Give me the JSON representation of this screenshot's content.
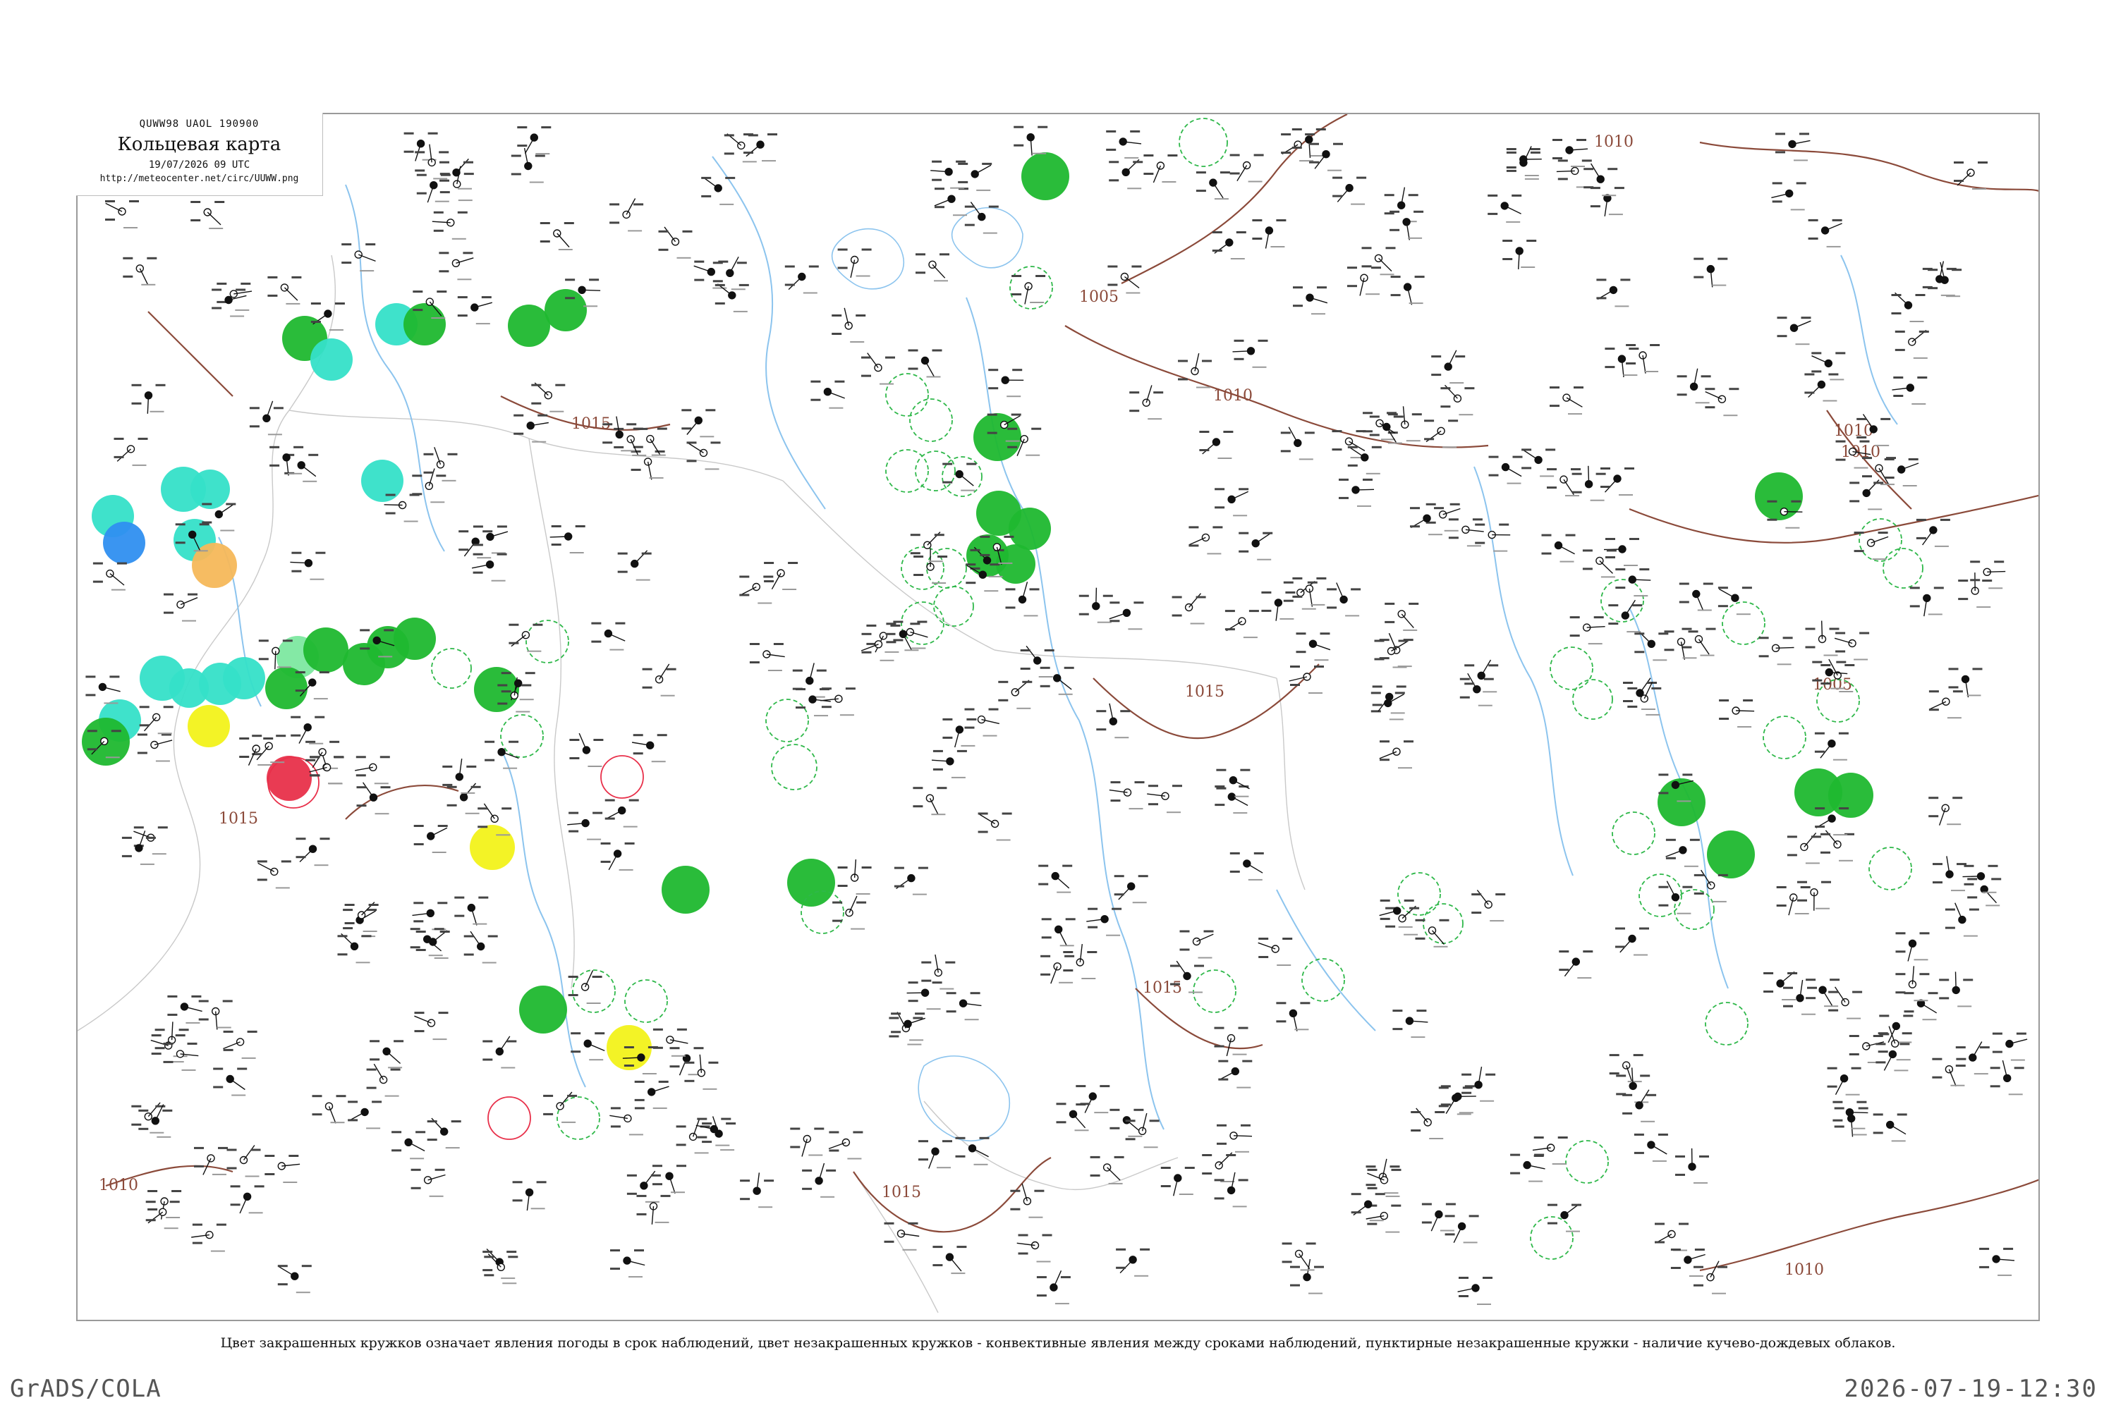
{
  "header": {
    "code": "QUWW98  UAOL  190900",
    "title": "Кольцевая карта",
    "date": "19/07/2026 09 UTC",
    "url": "http://meteocenter.net/circ/UUWW.png"
  },
  "isobars": [
    {
      "label": "1010"
    },
    {
      "label": "1005"
    },
    {
      "label": "1010"
    },
    {
      "label": "1015"
    },
    {
      "label": "1010"
    },
    {
      "label": "1005"
    },
    {
      "label": "1015"
    },
    {
      "label": "1015"
    },
    {
      "label": "1015"
    },
    {
      "label": "1010"
    },
    {
      "label": "1010"
    },
    {
      "label": "1010"
    },
    {
      "label": "1015"
    }
  ],
  "legend": "Цвет закрашенных кружков означает явления погоды в срок наблюдений, цвет незакрашенных кружков - конвективные явления между сроками наблюдений, пунктирные незакрашенные кружки - наличие кучево-дождевых облаков.",
  "footer": {
    "left": "GrADS/COLA",
    "right": "2026-07-19-12:30"
  },
  "colors": {
    "rain_green": "#1fb82f",
    "shower_cyan": "#35e0c8",
    "fog_blue": "#2f8ff0",
    "haze_orange": "#f5b85a",
    "drizzle_yellow": "#f2f21a",
    "thunder_red": "#e8304a",
    "light_green": "#7de8a0",
    "isobar_brown": "#8b4a3a",
    "river_blue": "#8cc4ee",
    "frame_gray": "#9a9a9a"
  }
}
